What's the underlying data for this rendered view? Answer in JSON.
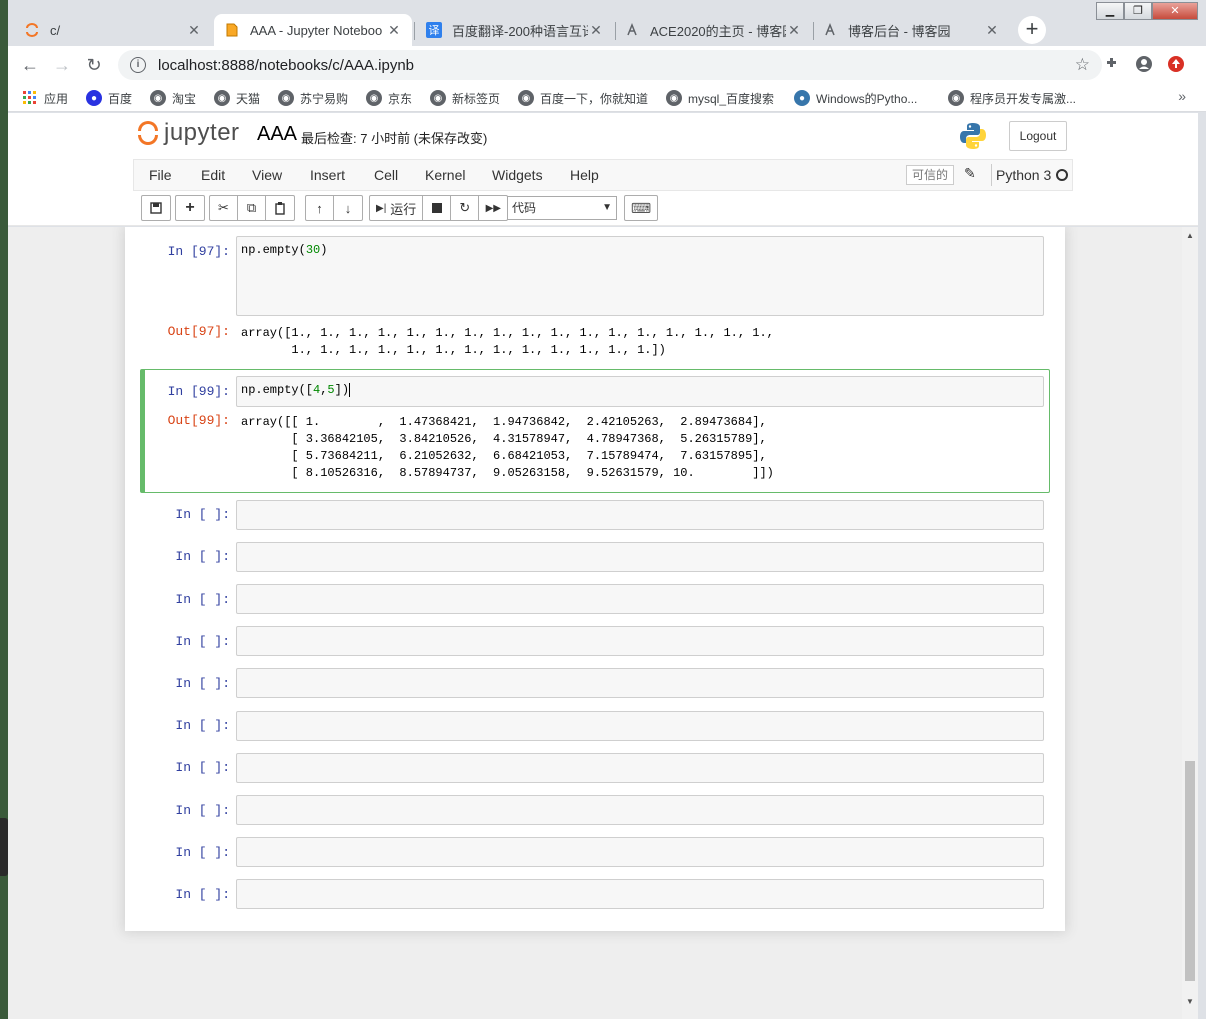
{
  "browser": {
    "tabs": [
      {
        "title": "c/",
        "icon": "jupyter-icon"
      },
      {
        "title": "AAA - Jupyter Noteboo",
        "icon": "document-icon"
      },
      {
        "title": "百度翻译-200种语言互译",
        "icon": "translate-icon"
      },
      {
        "title": "ACE2020的主页 - 博客园",
        "icon": "cnblogs-icon"
      },
      {
        "title": "博客后台 - 博客园",
        "icon": "cnblogs-icon"
      }
    ],
    "translate_glyph": "译",
    "url": "localhost:8888/notebooks/c/AAA.ipynb",
    "bookmarks": [
      {
        "label": "应用"
      },
      {
        "label": "百度"
      },
      {
        "label": "淘宝"
      },
      {
        "label": "天猫"
      },
      {
        "label": "苏宁易购"
      },
      {
        "label": "京东"
      },
      {
        "label": "新标签页"
      },
      {
        "label": "百度一下，你就知道"
      },
      {
        "label": "mysql_百度搜索"
      },
      {
        "label": "Windows的Pytho..."
      },
      {
        "label": "程序员开发专属激..."
      }
    ]
  },
  "jupyter": {
    "logo_text": "jupyter",
    "notebook_name": "AAA",
    "checkpoint": "最后检查: 7 小时前  (未保存改变)",
    "logout": "Logout",
    "menu": [
      "File",
      "Edit",
      "View",
      "Insert",
      "Cell",
      "Kernel",
      "Widgets",
      "Help"
    ],
    "trusted": "可信的",
    "kernel": "Python 3",
    "run_label": "运行",
    "cell_type": "代码"
  },
  "cells": {
    "c97": {
      "in_prompt": "In  [97]:",
      "code_fn": "np.empty(",
      "code_arg": "30",
      "code_close": ")",
      "out_prompt": "Out[97]:",
      "output": "array([1., 1., 1., 1., 1., 1., 1., 1., 1., 1., 1., 1., 1., 1., 1., 1., 1.,\n       1., 1., 1., 1., 1., 1., 1., 1., 1., 1., 1., 1., 1.])"
    },
    "c99": {
      "in_prompt": "In  [99]:",
      "code_fn": "np.empty([",
      "code_arg1": "4",
      "code_comma": ",",
      "code_arg2": "5",
      "code_close": "])",
      "out_prompt": "Out[99]:",
      "output": "array([[ 1.        ,  1.47368421,  1.94736842,  2.42105263,  2.89473684],\n       [ 3.36842105,  3.84210526,  4.31578947,  4.78947368,  5.26315789],\n       [ 5.73684211,  6.21052632,  6.68421053,  7.15789474,  7.63157895],\n       [ 8.10526316,  8.57894737,  9.05263158,  9.52631579, 10.        ]])"
    },
    "empty_prompt": "In  [  ]:"
  }
}
